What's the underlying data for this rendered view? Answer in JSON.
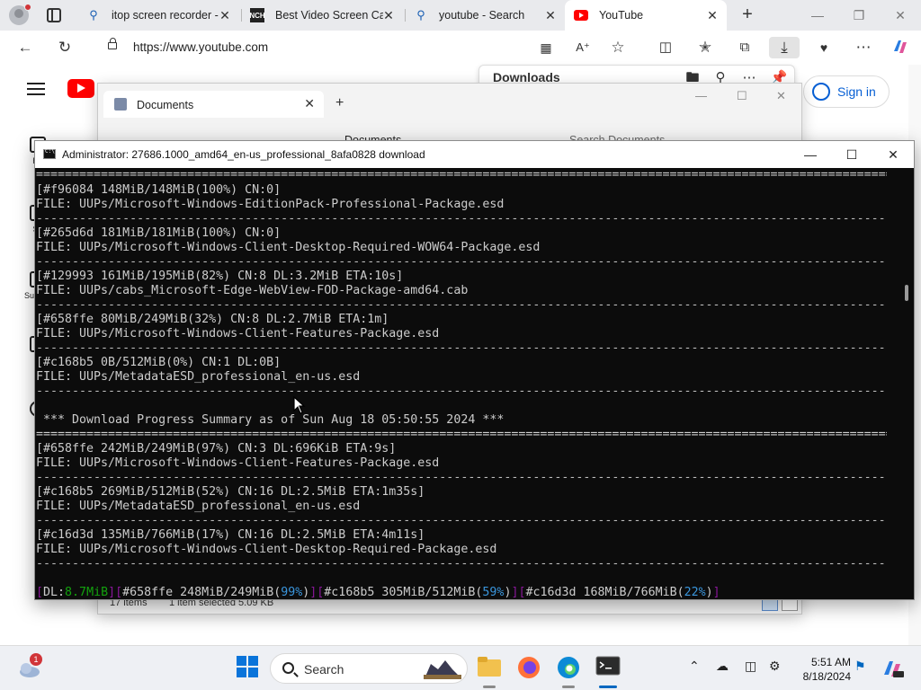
{
  "browser": {
    "tabs": [
      {
        "label": "itop screen recorder -"
      },
      {
        "label": "Best Video Screen Ca"
      },
      {
        "label": "youtube - Search"
      },
      {
        "label": "YouTube"
      }
    ],
    "url": "https://www.youtube.com"
  },
  "youtube": {
    "sidebar": [
      {
        "label": "Ho"
      },
      {
        "label": "Sh"
      },
      {
        "label": "Subscri"
      },
      {
        "label": "Y"
      },
      {
        "label": "Hi"
      }
    ],
    "signin_label": "Sign in"
  },
  "downloads": {
    "title": "Downloads"
  },
  "explorer": {
    "title": "Documents",
    "breadcrumb": "Documents",
    "search_placeholder": "Search Documents",
    "status_items": "17 items",
    "status_selected": "1 item selected  5.09 KB"
  },
  "console": {
    "title": "Administrator:  27686.1000_amd64_en-us_professional_8afa0828 download",
    "lines": [
      "[#f96084 148MiB/148MiB(100%) CN:0]",
      "FILE: UUPs/Microsoft-Windows-EditionPack-Professional-Package.esd",
      "[#265d6d 181MiB/181MiB(100%) CN:0]",
      "FILE: UUPs/Microsoft-Windows-Client-Desktop-Required-WOW64-Package.esd",
      "[#129993 161MiB/195MiB(82%) CN:8 DL:3.2MiB ETA:10s]",
      "FILE: UUPs/cabs_Microsoft-Edge-WebView-FOD-Package-amd64.cab",
      "[#658ffe 80MiB/249MiB(32%) CN:8 DL:2.7MiB ETA:1m]",
      "FILE: UUPs/Microsoft-Windows-Client-Features-Package.esd",
      "[#c168b5 0B/512MiB(0%) CN:1 DL:0B]",
      "FILE: UUPs/MetadataESD_professional_en-us.esd",
      " *** Download Progress Summary as of Sun Aug 18 05:50:55 2024 ***",
      "[#658ffe 242MiB/249MiB(97%) CN:3 DL:696KiB ETA:9s]",
      "FILE: UUPs/Microsoft-Windows-Client-Features-Package.esd",
      "[#c168b5 269MiB/512MiB(52%) CN:16 DL:2.5MiB ETA:1m35s]",
      "FILE: UUPs/MetadataESD_professional_en-us.esd",
      "[#c16d3d 135MiB/766MiB(17%) CN:16 DL:2.5MiB ETA:4m11s]",
      "FILE: UUPs/Microsoft-Windows-Client-Desktop-Required-Package.esd"
    ],
    "dash_rule": "--------------------------------------------------------------------------------------------------------------------------",
    "eq_rule": "==========================================================================================================================",
    "status": {
      "dl_label": "DL:",
      "dl_value": "8.7MiB",
      "p1": "#658ffe 248MiB/249MiB(",
      "p1_pct": "99%",
      "p2": "#c168b5 305MiB/512MiB(",
      "p2_pct": "59%",
      "p3": "#c16d3d 168MiB/766MiB(",
      "p3_pct": "22%"
    }
  },
  "taskbar": {
    "weather_badge": "1",
    "search_label": "Search",
    "time": "5:51 AM",
    "date": "8/18/2024"
  },
  "colors": {
    "accent": "#0067c0",
    "youtube_red": "#ff0000",
    "console_bg": "#0c0c0c",
    "console_green": "#13a10e",
    "console_cyan": "#3a96dd",
    "console_purple": "#881798"
  }
}
